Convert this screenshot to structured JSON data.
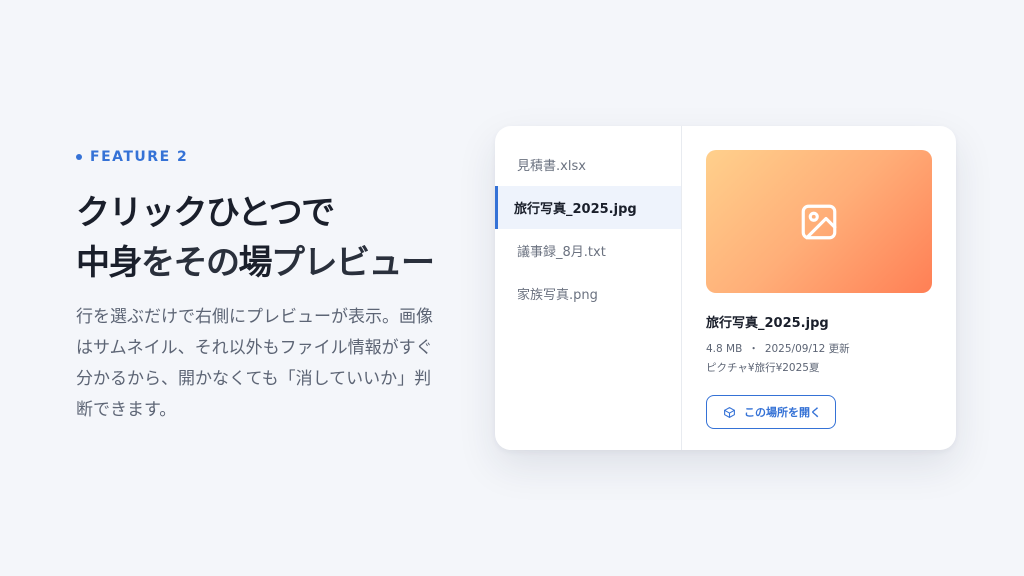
{
  "feature": {
    "label": "FEATURE 2"
  },
  "headline": {
    "line1": "クリックひとつで",
    "line2_bold1": "中身",
    "line2_mid": "をその",
    "line2_bold2": "場",
    "line2_tail": "プレビュー"
  },
  "description": "行を選ぶだけで右側にプレビューが表示。画像はサムネイル、それ以外もファイル情報がすぐ分かるから、開かなくても「消していいか」判断できます。",
  "files": [
    {
      "name": "見積書.xlsx",
      "active": false
    },
    {
      "name": "旅行写真_2025.jpg",
      "active": true
    },
    {
      "name": "議事録_8月.txt",
      "active": false
    },
    {
      "name": "家族写真.png",
      "active": false
    }
  ],
  "preview": {
    "thumbnail_icon": "image-icon",
    "file_name": "旅行写真_2025.jpg",
    "size": "4.8 MB",
    "separator": "・",
    "updated": "2025/09/12 更新",
    "path": "ピクチャ¥旅行¥2025夏",
    "open_button_label": "この場所を開く",
    "open_button_icon": "box-icon"
  },
  "colors": {
    "accent": "#3572d6",
    "background": "#f4f6fa",
    "thumb_gradient_start": "#ffd08c",
    "thumb_gradient_end": "#ff7f55"
  }
}
